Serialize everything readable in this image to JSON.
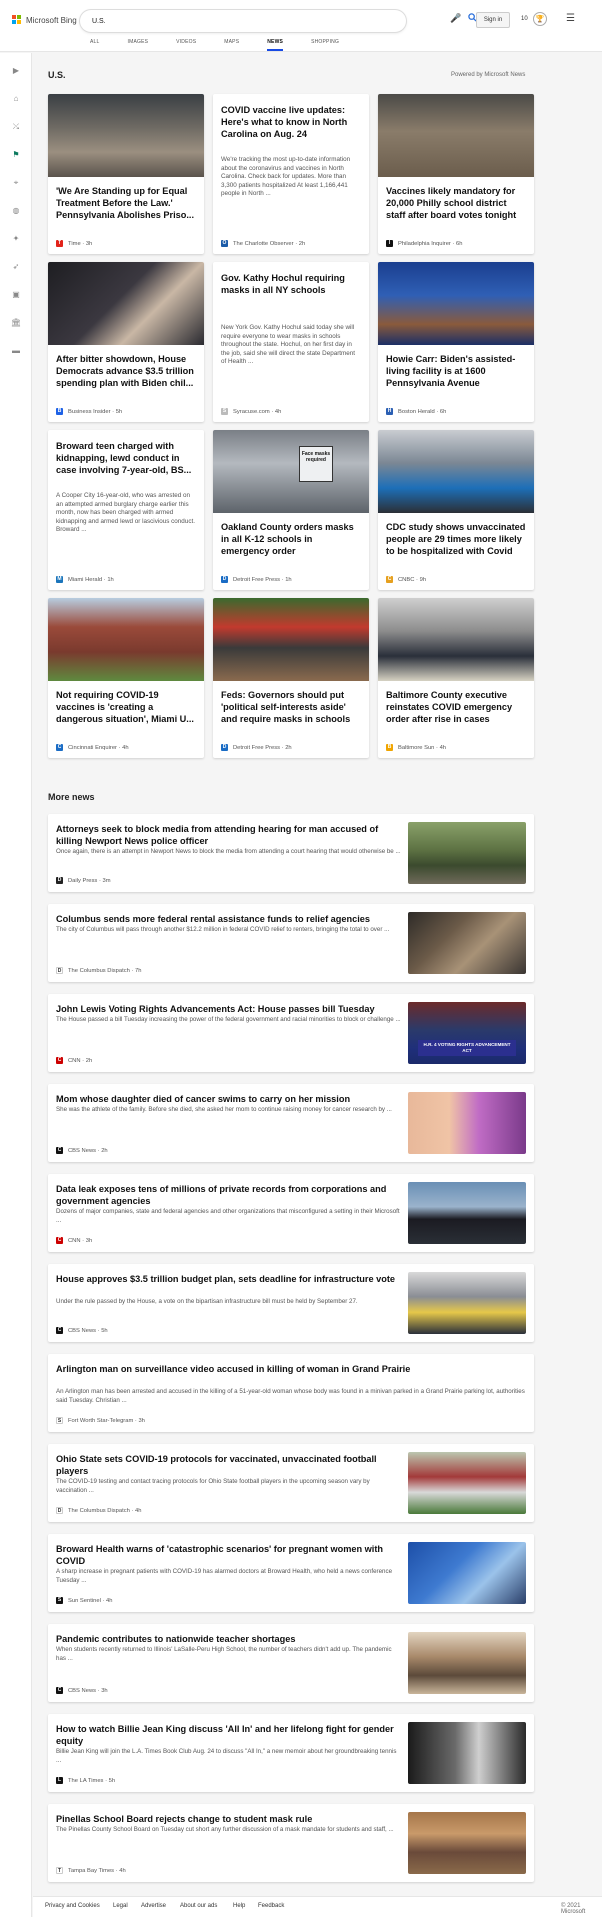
{
  "header": {
    "logo_text": "Microsoft Bing",
    "search_value": "U.S.",
    "signin_label": "Sign in",
    "rewards_count": "10",
    "tabs": [
      "ALL",
      "IMAGES",
      "VIDEOS",
      "MAPS",
      "NEWS",
      "SHOPPING"
    ],
    "active_tab": "NEWS"
  },
  "colors": {
    "accent": "#174ae4",
    "sidebar_active": "#0d7a5f"
  },
  "section": {
    "title": "U.S.",
    "powered_by": "Powered by Microsoft News"
  },
  "top_cards": [
    {
      "title": "'We Are Standing up for Equal Treatment Before the Law.' Pennsylvania Abolishes Priso...",
      "snippet": "",
      "source": "Time",
      "time": "3h",
      "favicon_color": "#e2231a",
      "favicon_letter": "T"
    },
    {
      "title": "COVID vaccine live updates: Here's what to know in North Carolina on Aug. 24",
      "snippet": "We're tracking the most up-to-date information about the coronavirus and vaccines in North Carolina. Check back for updates. More than 3,300 patients hospitalized At least 1,166,441 people in North ...",
      "source": "The Charlotte Observer",
      "time": "2h",
      "favicon_color": "#1a5ba8",
      "favicon_letter": "O"
    },
    {
      "title": "Vaccines likely mandatory for 20,000 Philly school district staff after board votes tonight",
      "snippet": "",
      "source": "Philadelphia Inquirer",
      "time": "6h",
      "favicon_color": "#111111",
      "favicon_letter": "I"
    },
    {
      "title": "After bitter showdown, House Democrats advance $3.5 trillion spending plan with Biden chil...",
      "snippet": "",
      "source": "Business Insider",
      "time": "5h",
      "favicon_color": "#1e62e6",
      "favicon_letter": "B"
    },
    {
      "title": "Gov. Kathy Hochul requiring masks in all NY schools",
      "snippet": "New York Gov. Kathy Hochul said today she will require everyone to wear masks in schools throughout the state. Hochul, on her first day in the job, said she will direct the state Department of Health ...",
      "source": "Syracuse.com",
      "time": "4h",
      "favicon_color": "#bbbbbb",
      "favicon_letter": "S"
    },
    {
      "title": "Howie Carr: Biden's assisted-living facility is at 1600 Pennsylvania Avenue",
      "snippet": "",
      "source": "Boston Herald",
      "time": "6h",
      "favicon_color": "#2b5fb3",
      "favicon_letter": "H"
    },
    {
      "title": "Broward teen charged with kidnapping, lewd conduct in case involving 7-year-old, BS...",
      "snippet": "A Cooper City 16-year-old, who was arrested on an attempted armed burglary charge earlier this month, now has been charged with armed kidnapping and armed lewd or lascivious conduct. Broward ...",
      "source": "Miami Herald",
      "time": "1h",
      "favicon_color": "#1b75bb",
      "favicon_letter": "M"
    },
    {
      "title": "Oakland County orders masks in all K-12 schools in emergency order",
      "snippet": "",
      "source": "Detroit Free Press",
      "time": "1h",
      "favicon_color": "#1a6cc5",
      "favicon_letter": "D"
    },
    {
      "title": "CDC study shows unvaccinated people are 29 times more likely to be hospitalized with Covid",
      "snippet": "",
      "source": "CNBC",
      "time": "9h",
      "favicon_color": "#e6a01e",
      "favicon_letter": "C"
    },
    {
      "title": "Not requiring COVID-19 vaccines is 'creating a dangerous situation', Miami U...",
      "snippet": "",
      "source": "Cincinnati Enquirer",
      "time": "4h",
      "favicon_color": "#1a6cc5",
      "favicon_letter": "C"
    },
    {
      "title": "Feds: Governors should put 'political self-interests aside' and require masks in schools",
      "snippet": "",
      "source": "Detroit Free Press",
      "time": "2h",
      "favicon_color": "#1a6cc5",
      "favicon_letter": "D"
    },
    {
      "title": "Baltimore County executive reinstates COVID emergency order after rise in cases",
      "snippet": "",
      "source": "Baltimore Sun",
      "time": "4h",
      "favicon_color": "#f0a500",
      "favicon_letter": "B"
    }
  ],
  "more_news": {
    "title": "More news",
    "items": [
      {
        "title": "Attorneys seek to block media from attending hearing for man accused of killing Newport News police officer",
        "snippet": "Once again, there is an attempt in Newport News to block the media from attending a court hearing that would otherwise be ...",
        "source": "Daily Press",
        "time": "3m",
        "favicon_color": "#222222",
        "favicon_letter": "D"
      },
      {
        "title": "Columbus sends more federal rental assistance funds to relief agencies",
        "snippet": "The city of Columbus will pass through another $12.2 million in federal COVID relief to renters, bringing the total to over ...",
        "source": "The Columbus Dispatch",
        "time": "7h",
        "favicon_color": "#ffffff",
        "favicon_letter": "D"
      },
      {
        "title": "John Lewis Voting Rights Advancements Act: House passes bill Tuesday",
        "snippet": "The House passed a bill Tuesday increasing the power of the federal government and racial minorities to block or challenge ...",
        "source": "CNN",
        "time": "2h",
        "favicon_color": "#cc0000",
        "favicon_letter": "C",
        "thumb_caption": "H.R. 4 VOTING RIGHTS ADVANCEMENT ACT"
      },
      {
        "title": "Mom whose daughter died of cancer swims to carry on her mission",
        "snippet": "She was the athlete of the family. Before she died, she asked her mom to continue raising money for cancer research by ...",
        "source": "CBS News",
        "time": "2h",
        "favicon_color": "#111111",
        "favicon_letter": "C"
      },
      {
        "title": "Data leak exposes tens of millions of private records from corporations and government agencies",
        "snippet": "Dozens of major companies, state and federal agencies and other organizations that misconfigured a setting in their Microsoft ...",
        "source": "CNN",
        "time": "3h",
        "favicon_color": "#cc0000",
        "favicon_letter": "C"
      },
      {
        "title": "House approves $3.5 trillion budget plan, sets deadline for infrastructure vote",
        "snippet": "Under the rule passed by the House, a vote on the bipartisan infrastructure bill must be held by September 27.",
        "source": "CBS News",
        "time": "5h",
        "favicon_color": "#111111",
        "favicon_letter": "C"
      },
      {
        "title": "Arlington man on surveillance video accused in killing of woman in Grand Prairie",
        "snippet": "An Arlington man has been arrested and accused in the killing of a 51-year-old woman whose body was found in a minivan parked in a Grand Prairie parking lot, authorities said Tuesday. Christian ...",
        "source": "Fort Worth Star-Telegram",
        "time": "3h",
        "favicon_color": "#ffffff",
        "favicon_letter": "S"
      },
      {
        "title": "Ohio State sets COVID-19 protocols for vaccinated, unvaccinated football players",
        "snippet": "The COVID-19 testing and contact tracing protocols for Ohio State football players in the upcoming season vary by vaccination ...",
        "source": "The Columbus Dispatch",
        "time": "4h",
        "favicon_color": "#ffffff",
        "favicon_letter": "D"
      },
      {
        "title": "Broward Health warns of 'catastrophic scenarios' for pregnant women with COVID",
        "snippet": "A sharp increase in pregnant patients with COVID-19 has alarmed doctors at Broward Health, who held a news conference Tuesday ...",
        "source": "Sun Sentinel",
        "time": "4h",
        "favicon_color": "#111111",
        "favicon_letter": "S"
      },
      {
        "title": "Pandemic contributes to nationwide teacher shortages",
        "snippet": "When students recently returned to Illinois' LaSalle-Peru High School, the number of teachers didn't add up. The pandemic has ...",
        "source": "CBS News",
        "time": "3h",
        "favicon_color": "#111111",
        "favicon_letter": "C"
      },
      {
        "title": "How to watch Billie Jean King discuss 'All In' and her lifelong fight for gender equity",
        "snippet": "Billie Jean King will join the L.A. Times Book Club Aug. 24 to discuss \"All In,\" a new memoir about her groundbreaking tennis ...",
        "source": "The LA Times",
        "time": "5h",
        "favicon_color": "#111111",
        "favicon_letter": "L"
      },
      {
        "title": "Pinellas School Board rejects change to student mask rule",
        "snippet": "The Pinellas County School Board on Tuesday cut short any further discussion of a mask mandate for students and staff, ...",
        "source": "Tampa Bay Times",
        "time": "4h",
        "favicon_color": "#ffffff",
        "favicon_letter": "T"
      }
    ]
  },
  "top_card_thumb_text": {
    "oakland_sign": "Face masks required"
  },
  "footer": {
    "links": [
      "Privacy and Cookies",
      "Legal",
      "Advertise",
      "About our ads",
      "Help",
      "Feedback"
    ],
    "copyright": "© 2021 Microsoft"
  }
}
